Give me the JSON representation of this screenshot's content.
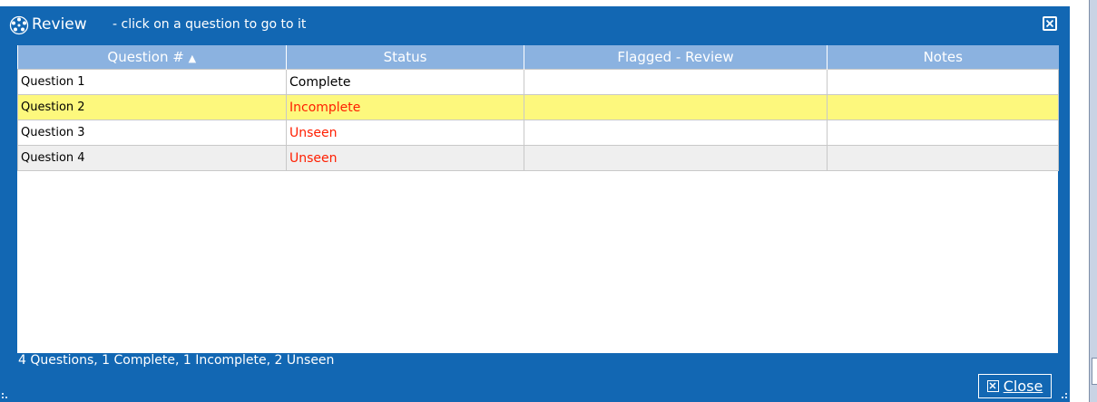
{
  "dialog": {
    "title": "Review",
    "subtitle": "- click on a question to go to it",
    "close_icon": "close-box-icon",
    "title_icon": "review-spinner-icon",
    "colors": {
      "frame": "#1267b3",
      "header": "#8bb2e0",
      "selected_row": "#fdf87d",
      "alert_text": "#ff1e00"
    }
  },
  "table": {
    "columns": [
      {
        "label": "Question #",
        "sort_indicator": "▲"
      },
      {
        "label": "Status"
      },
      {
        "label": "Flagged - Review"
      },
      {
        "label": "Notes"
      }
    ],
    "rows": [
      {
        "question": "Question 1",
        "status": "Complete",
        "flagged": "",
        "notes": ""
      },
      {
        "question": "Question 2",
        "status": "Incomplete",
        "flagged": "",
        "notes": ""
      },
      {
        "question": "Question 3",
        "status": "Unseen",
        "flagged": "",
        "notes": ""
      },
      {
        "question": "Question 4",
        "status": "Unseen",
        "flagged": "",
        "notes": ""
      }
    ]
  },
  "footer": {
    "summary": "4 Questions, 1 Complete, 1 Incomplete, 2 Unseen",
    "close_label": "Close"
  }
}
